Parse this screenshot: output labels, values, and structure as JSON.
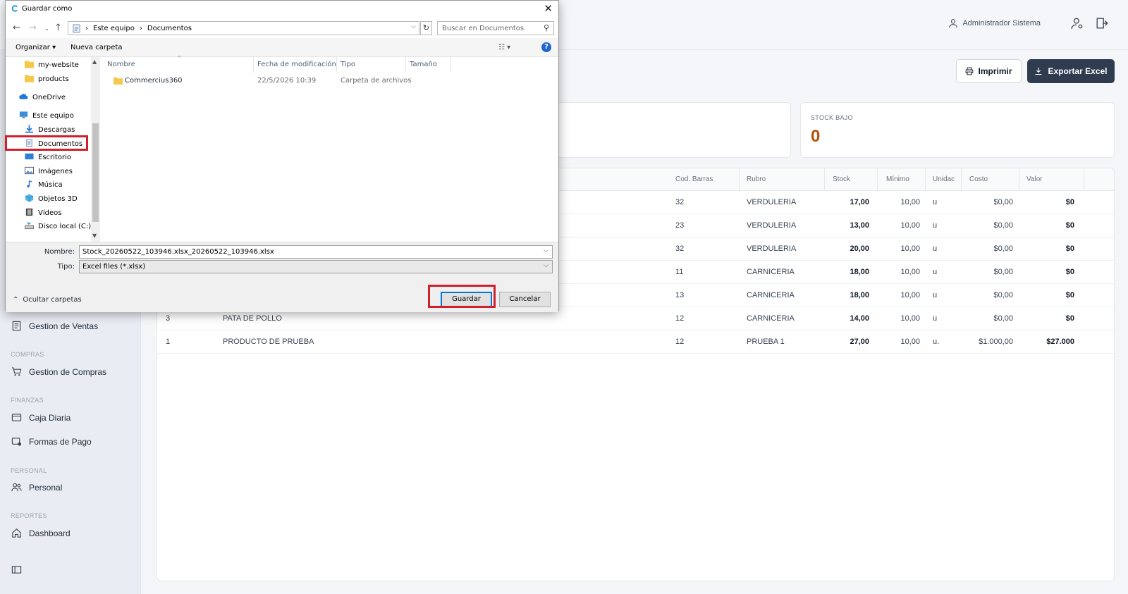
{
  "header": {
    "user_name": "Administrador Sistema",
    "print_label": "Imprimir",
    "export_label": "Exportar Excel"
  },
  "stats": {
    "low_stock_label": "STOCK BAJO",
    "low_stock_value": "0"
  },
  "sidebar": {
    "items": [
      {
        "label": "Gestion de Ventas"
      },
      {
        "section": "COMPRAS"
      },
      {
        "label": "Gestion de Compras"
      },
      {
        "section": "FINANZAS"
      },
      {
        "label": "Caja Diaria"
      },
      {
        "label": "Formas de Pago"
      },
      {
        "section": "PERSONAL"
      },
      {
        "label": "Personal"
      },
      {
        "section": "REPORTES"
      },
      {
        "label": "Dashboard"
      }
    ]
  },
  "table": {
    "columns": [
      "Cod. Barras",
      "Rubro",
      "Stock",
      "Mínimo",
      "Unidac",
      "Costo",
      "Valor"
    ],
    "rows": [
      {
        "id": "",
        "name": "",
        "barcode": "32",
        "rubro": "VERDULERIA",
        "stock": "17,00",
        "min": "10,00",
        "unit": "u",
        "cost": "$0,00",
        "value": "$0"
      },
      {
        "id": "",
        "name": "",
        "barcode": "23",
        "rubro": "VERDULERIA",
        "stock": "13,00",
        "min": "10,00",
        "unit": "u",
        "cost": "$0,00",
        "value": "$0"
      },
      {
        "id": "",
        "name": "",
        "barcode": "32",
        "rubro": "VERDULERIA",
        "stock": "20,00",
        "min": "10,00",
        "unit": "u",
        "cost": "$0,00",
        "value": "$0"
      },
      {
        "id": "",
        "name": "",
        "barcode": "11",
        "rubro": "CARNICERIA",
        "stock": "18,00",
        "min": "10,00",
        "unit": "u",
        "cost": "$0,00",
        "value": "$0"
      },
      {
        "id": "",
        "name": "",
        "barcode": "13",
        "rubro": "CARNICERIA",
        "stock": "18,00",
        "min": "10,00",
        "unit": "u",
        "cost": "$0,00",
        "value": "$0"
      },
      {
        "id": "3",
        "name": "PATA DE POLLO",
        "barcode": "12",
        "rubro": "CARNICERIA",
        "stock": "14,00",
        "min": "10,00",
        "unit": "u",
        "cost": "$0,00",
        "value": "$0"
      },
      {
        "id": "1",
        "name": "PRODUCTO DE PRUEBA",
        "barcode": "12",
        "rubro": "PRUEBA 1",
        "stock": "27,00",
        "min": "10,00",
        "unit": "u.",
        "cost": "$1.000,00",
        "value": "$27.000"
      }
    ]
  },
  "dialog": {
    "title": "Guardar como",
    "breadcrumb": [
      "Este equipo",
      "Documentos"
    ],
    "search_placeholder": "Buscar en Documentos",
    "organize_label": "Organizar ▾",
    "new_folder_label": "Nueva carpeta",
    "help_label": "?",
    "tree": [
      {
        "label": "my-website",
        "icon": "folder-icon"
      },
      {
        "label": "products",
        "icon": "folder-icon"
      },
      {
        "label": "OneDrive",
        "icon": "cloud-icon"
      },
      {
        "label": "Este equipo",
        "icon": "computer-icon"
      },
      {
        "label": "Descargas",
        "icon": "download-icon"
      },
      {
        "label": "Documentos",
        "icon": "document-icon"
      },
      {
        "label": "Escritorio",
        "icon": "desktop-icon"
      },
      {
        "label": "Imágenes",
        "icon": "image-icon"
      },
      {
        "label": "Música",
        "icon": "music-icon"
      },
      {
        "label": "Objetos 3D",
        "icon": "cube-icon"
      },
      {
        "label": "Vídeos",
        "icon": "video-icon"
      },
      {
        "label": "Disco local (C:)",
        "icon": "drive-icon"
      }
    ],
    "columns": [
      "Nombre",
      "Fecha de modificación",
      "Tipo",
      "Tamaño"
    ],
    "files": [
      {
        "name": "Commercius360",
        "modified": "22/5/2026 10:39",
        "type": "Carpeta de archivos",
        "size": ""
      }
    ],
    "filename_label": "Nombre:",
    "filename_value": "Stock_20260522_103946.xlsx_20260522_103946.xlsx",
    "type_label": "Tipo:",
    "type_value": "Excel files (*.xlsx)",
    "hide_folders_label": "Ocultar carpetas",
    "save_label": "Guardar",
    "cancel_label": "Cancelar"
  },
  "colors": {
    "accent_dark": "#2f3b4f",
    "low_stock": "#b45309",
    "highlight": "#d0202b"
  }
}
